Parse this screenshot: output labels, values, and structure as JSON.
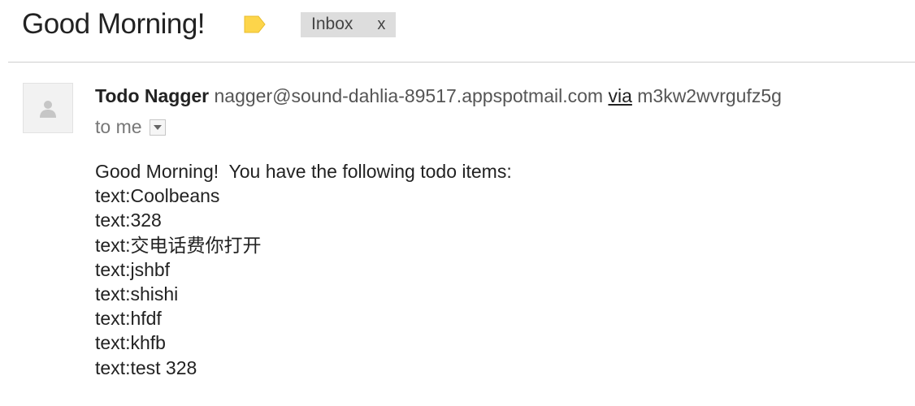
{
  "email": {
    "subject": "Good Morning!",
    "label_chip": {
      "text": "Inbox",
      "remove": "x"
    },
    "sender": {
      "name": "Todo Nagger",
      "email": "nagger@sound-dahlia-89517.appspotmail.com",
      "via_label": "via",
      "via_domain": "m3kw2wvrgufz5g"
    },
    "recipient_text": "to me",
    "body": {
      "intro": "Good Morning!  You have the following todo items:",
      "items": [
        "text:Coolbeans",
        "text:328",
        "text:交电话费你打开",
        "text:jshbf",
        "text:shishi",
        "text:hfdf",
        "text:khfb",
        "text:test 328"
      ]
    }
  },
  "icons": {
    "label": "label-tag-icon",
    "avatar": "person-icon",
    "details": "caret-down-icon"
  },
  "colors": {
    "label_tag": "#FDD54A",
    "chip_background": "#DDDDDD",
    "divider": "#CFCFCF",
    "avatar_background": "#F2F2F2"
  }
}
